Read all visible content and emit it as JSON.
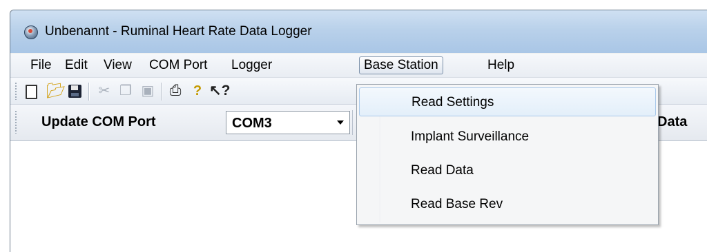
{
  "window": {
    "title": "Unbenannt - Ruminal Heart Rate Data Logger",
    "icon": "app-globe-icon"
  },
  "menubar": {
    "items": [
      "File",
      "Edit",
      "View",
      "COM Port",
      "Logger",
      "Base Station",
      "Help"
    ],
    "active": "Base Station"
  },
  "toolbar": {
    "icons": [
      "new-document-icon",
      "open-folder-icon",
      "save-icon",
      "cut-icon",
      "copy-icon",
      "paste-icon",
      "print-icon",
      "help-icon",
      "whats-this-icon"
    ],
    "disabled": [
      "cut-icon",
      "copy-icon",
      "paste-icon"
    ]
  },
  "com_toolbar": {
    "update_label": "Update COM Port",
    "com_port_value": "COM3",
    "right_label_partial": "Data"
  },
  "base_station_menu": {
    "items": [
      "Read Settings",
      "Implant Surveillance",
      "Read Data",
      "Read Base Rev"
    ],
    "highlighted": "Read Settings"
  }
}
